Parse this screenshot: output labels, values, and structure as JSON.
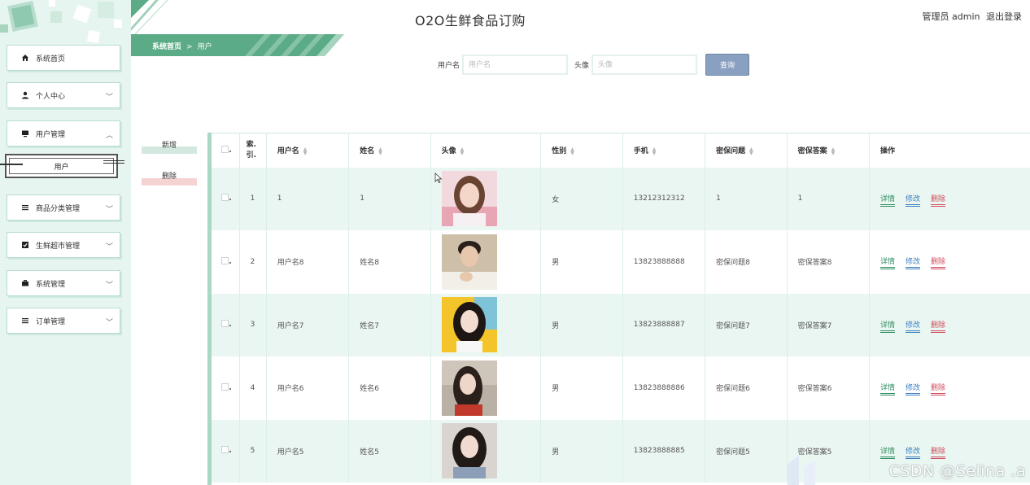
{
  "app_title": "O2O生鲜食品订购",
  "header": {
    "admin_label": "管理员 admin",
    "logout_label": "退出登录"
  },
  "breadcrumb": {
    "home": "系统首页",
    "separator": ">",
    "current": "用户"
  },
  "sidebar": {
    "items": [
      {
        "label": "系统首页",
        "icon": "home-icon"
      },
      {
        "label": "个人中心",
        "icon": "user-icon"
      },
      {
        "label": "用户管理",
        "icon": "monitor-icon"
      },
      {
        "label": "商品分类管理",
        "icon": "list-icon"
      },
      {
        "label": "生鲜超市管理",
        "icon": "checkbox-icon"
      },
      {
        "label": "系统管理",
        "icon": "briefcase-icon"
      },
      {
        "label": "订单管理",
        "icon": "list-icon"
      }
    ],
    "sub_item": "用户"
  },
  "search": {
    "username_label": "用户名",
    "username_placeholder": "用户名",
    "avatar_label": "头像",
    "avatar_placeholder": "头像",
    "query_label": "查询"
  },
  "actions": {
    "add_label": "新增",
    "delete_label": "删除"
  },
  "table": {
    "columns": [
      "索引",
      "用户名",
      "姓名",
      "头像",
      "性别",
      "手机",
      "密保问题",
      "密保答案",
      "操作"
    ],
    "index_header_line1": "索.",
    "index_header_line2": "引.",
    "rows": [
      {
        "index": "1",
        "username": "1",
        "name": "1",
        "gender": "女",
        "phone": "13212312312",
        "question": "1",
        "answer": "1"
      },
      {
        "index": "2",
        "username": "用户名8",
        "name": "姓名8",
        "gender": "男",
        "phone": "13823888888",
        "question": "密保问题8",
        "answer": "密保答案8"
      },
      {
        "index": "3",
        "username": "用户名7",
        "name": "姓名7",
        "gender": "男",
        "phone": "13823888887",
        "question": "密保问题7",
        "answer": "密保答案7"
      },
      {
        "index": "4",
        "username": "用户名6",
        "name": "姓名6",
        "gender": "男",
        "phone": "13823888886",
        "question": "密保问题6",
        "answer": "密保答案6"
      },
      {
        "index": "5",
        "username": "用户名5",
        "name": "姓名5",
        "gender": "男",
        "phone": "13823888885",
        "question": "密保问题5",
        "answer": "密保答案5"
      }
    ],
    "ops": {
      "detail": "详情",
      "edit": "修改",
      "delete": "删除"
    }
  },
  "watermark": "CSDN @Selina .a",
  "colors": {
    "accent": "#5bab86",
    "sidebar_bg": "#e6f5ef",
    "row_alt": "#eaf6f1",
    "query_button": "#8aa0c0"
  }
}
